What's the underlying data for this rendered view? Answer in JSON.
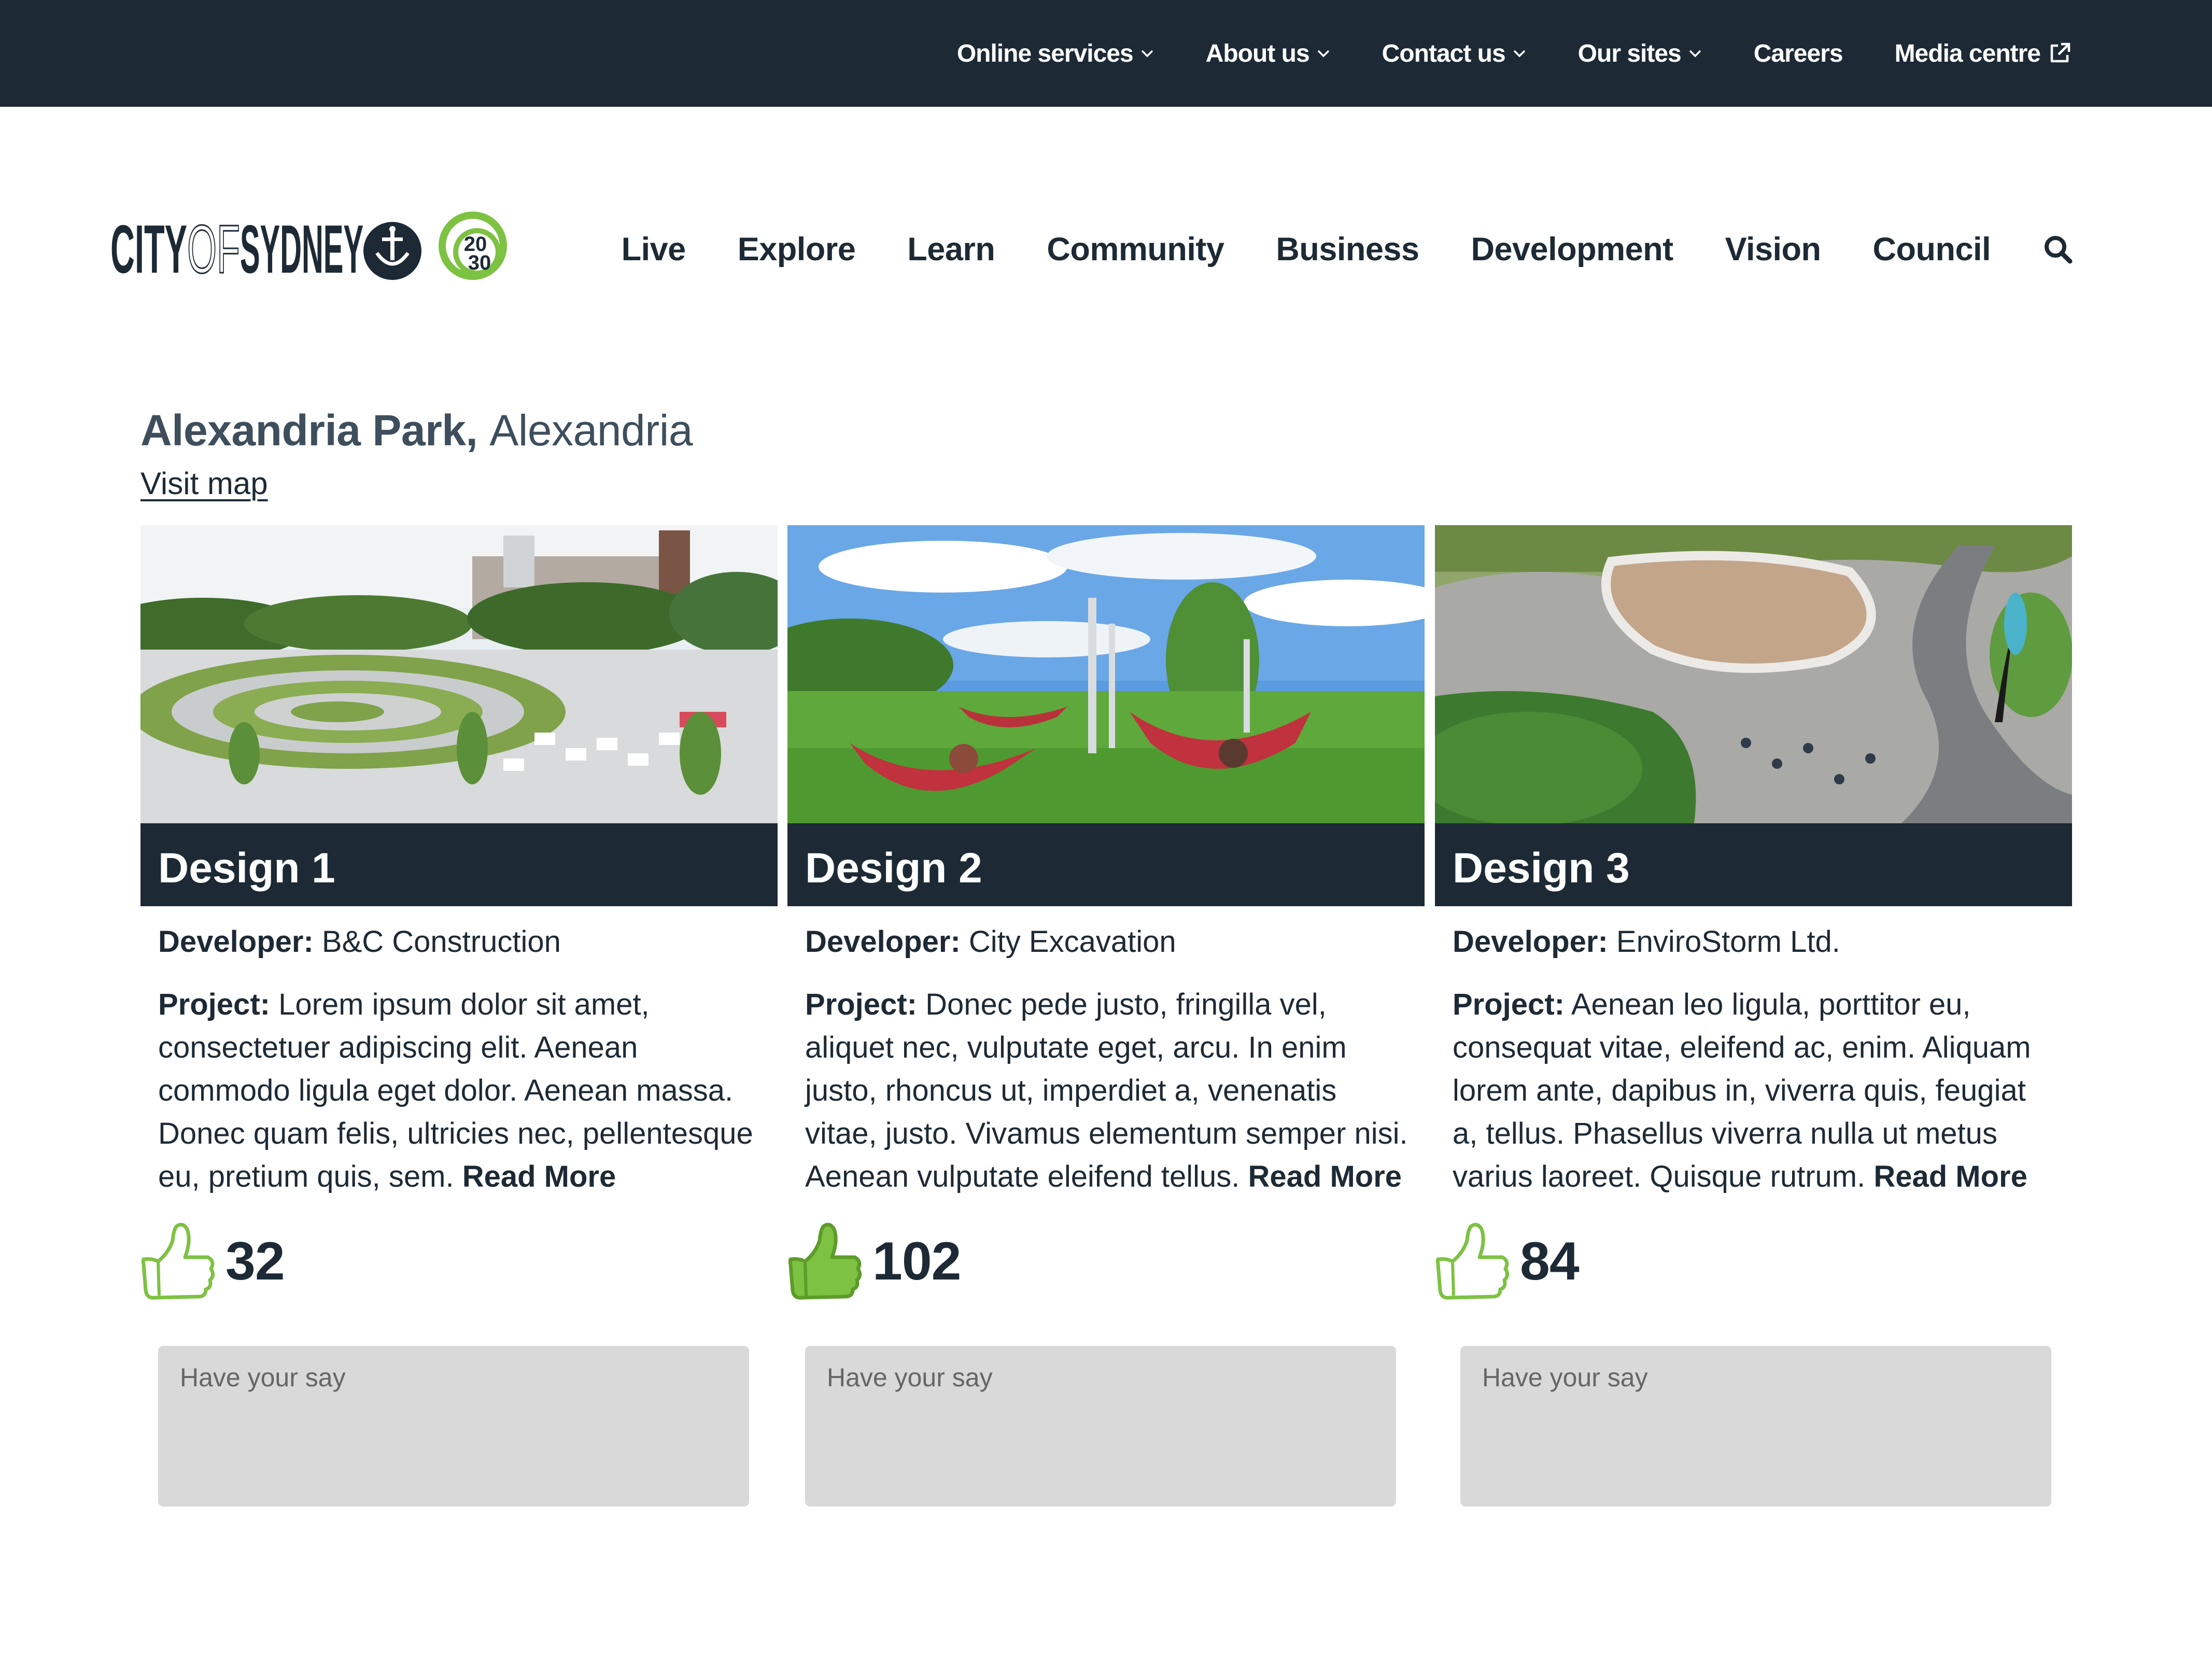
{
  "utility_nav": {
    "items": [
      {
        "label": "Online services",
        "has_dropdown": true
      },
      {
        "label": "About us",
        "has_dropdown": true
      },
      {
        "label": "Contact us",
        "has_dropdown": true
      },
      {
        "label": "Our sites",
        "has_dropdown": true
      },
      {
        "label": "Careers",
        "has_dropdown": false
      },
      {
        "label": "Media centre",
        "external": true
      }
    ]
  },
  "logo": {
    "text_city": "CITY",
    "text_of": "OF",
    "text_sydney": "SYDNEY",
    "badge_top": "20",
    "badge_bottom": "30"
  },
  "main_nav": {
    "items": [
      "Live",
      "Explore",
      "Learn",
      "Community",
      "Business",
      "Development",
      "Vision",
      "Council"
    ],
    "search_icon": "search-icon"
  },
  "page": {
    "title_strong": "Alexandria Park,",
    "title_light": "Alexandria",
    "visit_map": "Visit map"
  },
  "designs": [
    {
      "title": "Design 1",
      "developer_label": "Developer:",
      "developer": "B&C Construction",
      "project_label": "Project:",
      "project": "Lorem ipsum dolor sit amet, consectetuer adipiscing elit. Aenean commodo ligula eget dolor. Aenean massa. Donec quam felis, ultricies nec, pellentesque eu, pretium quis, sem.",
      "read_more": "Read More",
      "likes": "32",
      "liked": false,
      "comment_placeholder": "Have your say"
    },
    {
      "title": "Design 2",
      "developer_label": "Developer:",
      "developer": "City Excavation",
      "project_label": "Project:",
      "project": "Donec pede justo, fringilla vel, aliquet nec, vulputate eget, arcu. In enim justo, rhoncus ut, imperdiet a, venenatis vitae, justo. Vivamus elementum semper nisi. Aenean vulputate eleifend tellus.",
      "read_more": "Read More",
      "likes": "102",
      "liked": true,
      "comment_placeholder": "Have your say"
    },
    {
      "title": "Design 3",
      "developer_label": "Developer:",
      "developer": "EnviroStorm Ltd.",
      "project_label": "Project:",
      "project": "Aenean leo ligula, porttitor eu, consequat vitae, eleifend ac, enim. Aliquam lorem ante, dapibus in, viverra quis, feugiat a, tellus. Phasellus viverra nulla ut metus varius laoreet. Quisque rutrum.",
      "read_more": "Read More",
      "likes": "84",
      "liked": false,
      "comment_placeholder": "Have your say"
    }
  ],
  "colors": {
    "dark_navy": "#1d2a35",
    "heading_grey": "#3e4e5c",
    "accent_green": "#7dc242",
    "comment_bg": "#d9d9d9"
  }
}
